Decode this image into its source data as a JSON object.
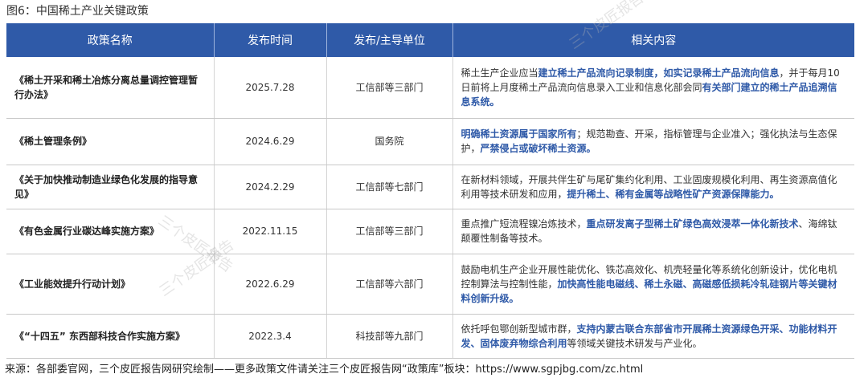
{
  "figure_title": "图6：中国稀土产业关键政策",
  "headers": [
    "政策名称",
    "发布时间",
    "发布/主导单位",
    "相关内容"
  ],
  "rows": [
    {
      "name": "《稀土开采和稀土冶炼分离总量调控管理暂行办法》",
      "date": "2025.7.28",
      "org": "工信部等三部门",
      "content": [
        {
          "t": "稀土生产企业应当",
          "hl": false
        },
        {
          "t": "建立稀土产品流向记录制度，如实记录稀土产品流向信息",
          "hl": true
        },
        {
          "t": "，并于每月10日前将上月度稀土产品流向信息录入工业和信息化部会同",
          "hl": false
        },
        {
          "t": "有关部门建立的稀土产品追溯信息系统。",
          "hl": true
        }
      ]
    },
    {
      "name": "《稀土管理条例》",
      "date": "2024.6.29",
      "org": "国务院",
      "content": [
        {
          "t": "明确稀土资源属于国家所有",
          "hl": true
        },
        {
          "t": "；规范勘查、开采，指标管理与企业准入；强化执法与生态保护，",
          "hl": false
        },
        {
          "t": "严禁侵占或破坏稀土资源。",
          "hl": true
        }
      ]
    },
    {
      "name": "《关于加快推动制造业绿色化发展的指导意见》",
      "date": "2024.2.29",
      "org": "工信部等七部门",
      "content": [
        {
          "t": "在新材料领域，开展共伴生矿与尾矿集约化利用、工业固废规模化利用、再生资源高值化利用等技术研发和应用，",
          "hl": false
        },
        {
          "t": "提升稀土、稀有金属等战略性矿产资源保障能力。",
          "hl": true
        }
      ]
    },
    {
      "name": "《有色金属行业碳达峰实施方案》",
      "date": "2022.11.15",
      "org": "工信部等三部门",
      "content": [
        {
          "t": "重点推广短流程镍冶炼技术，",
          "hl": false
        },
        {
          "t": "重点研发离子型稀土矿绿色高效浸萃一体化新技术",
          "hl": true
        },
        {
          "t": "、海绵钛颠覆性制备等技术。",
          "hl": false
        }
      ]
    },
    {
      "name": "《工业能效提升行动计划》",
      "date": "2022.6.29",
      "org": "工信部等六部门",
      "content": [
        {
          "t": "鼓励电机生产企业开展性能优化、铁芯高效化、机壳轻量化等系统化创新设计，优化电机控制算法与控制性能，",
          "hl": false
        },
        {
          "t": "加快高性能电磁线、稀土永磁、高磁感低损耗冷轧硅钢片等关键材料创新升级。",
          "hl": true
        }
      ]
    },
    {
      "name": "《“十四五” 东西部科技合作实施方案》",
      "date": "2022.3.4",
      "org": "科技部等九部门",
      "content": [
        {
          "t": "依托呼包鄂创新型城市群，",
          "hl": false
        },
        {
          "t": "支持内蒙古联合东部省市开展稀土资源绿色开采、功能材料开发、固体废弃物综合利用",
          "hl": true
        },
        {
          "t": "等领域关键技术研发与产业化。",
          "hl": false
        }
      ]
    }
  ],
  "source": "来源：各部委官网，三个皮匠报告网研究绘制——更多政策文件请关注三个皮匠报告网“政策库”板块：https://www.sgpjbg.com/zc.html",
  "watermark": "三个皮匠报告",
  "colors": {
    "header_bg": "#2f5aa8",
    "highlight": "#2f5aa8"
  }
}
